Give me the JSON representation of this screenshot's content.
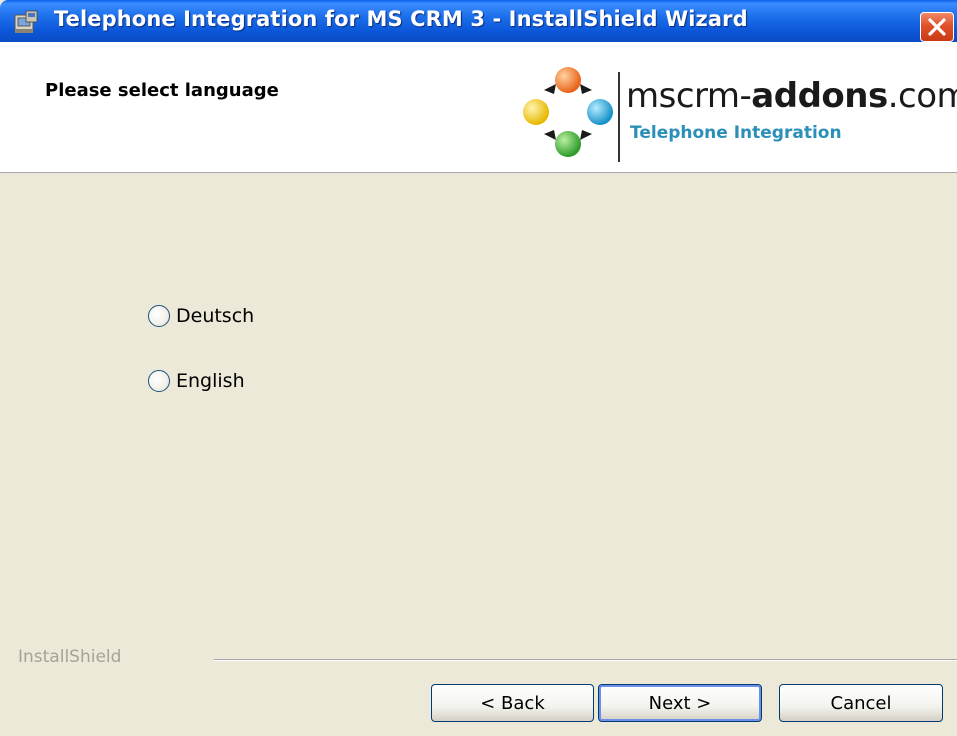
{
  "window": {
    "title": "Telephone Integration for MS CRM 3 - InstallShield Wizard",
    "title_icon": "installer-icon",
    "close_icon": "close-icon"
  },
  "banner": {
    "heading": "Please select language",
    "logo": {
      "text_light": "mscrm-",
      "text_bold": "addons",
      "text_suffix": ".com",
      "subtitle": "Telephone Integration"
    }
  },
  "options": [
    {
      "label": "Deutsch",
      "selected": false
    },
    {
      "label": "English",
      "selected": false
    }
  ],
  "footer": {
    "brand": "InstallShield"
  },
  "buttons": {
    "back": "< Back",
    "next": "Next >",
    "cancel": "Cancel"
  },
  "colors": {
    "titlebar": "#0b56d8",
    "dialog_bg": "#ece9d8",
    "close": "#e0502a",
    "logo_subtitle": "#2b8fb8"
  }
}
